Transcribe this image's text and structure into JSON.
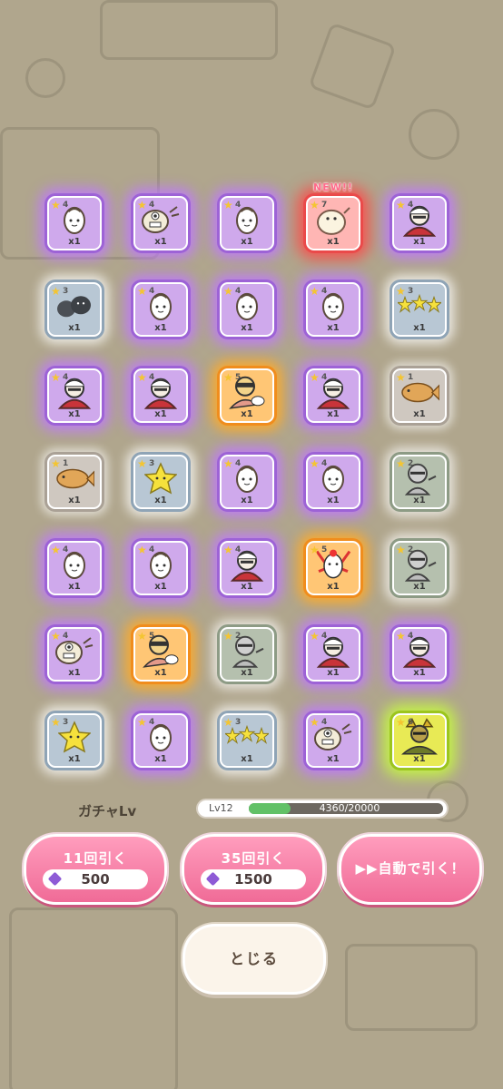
{
  "tiles": [
    {
      "rarity": "4",
      "qty": "x1",
      "color": "purple",
      "art": "egg-face"
    },
    {
      "rarity": "4",
      "qty": "x1",
      "color": "purple",
      "art": "one-eye-creature"
    },
    {
      "rarity": "4",
      "qty": "x1",
      "color": "purple",
      "art": "egg-face"
    },
    {
      "rarity": "7",
      "qty": "x1",
      "color": "red",
      "art": "blob-creature",
      "new": "NEW!!"
    },
    {
      "rarity": "4",
      "qty": "x1",
      "color": "purple",
      "art": "bandana-man"
    },
    {
      "rarity": "3",
      "qty": "x1",
      "color": "blue",
      "art": "dark-blobs"
    },
    {
      "rarity": "4",
      "qty": "x1",
      "color": "purple",
      "art": "egg-face"
    },
    {
      "rarity": "4",
      "qty": "x1",
      "color": "purple",
      "art": "egg-face"
    },
    {
      "rarity": "4",
      "qty": "x1",
      "color": "purple",
      "art": "egg-face"
    },
    {
      "rarity": "3",
      "qty": "x1",
      "color": "blue",
      "art": "three-stars"
    },
    {
      "rarity": "4",
      "qty": "x1",
      "color": "purple",
      "art": "bandana-man"
    },
    {
      "rarity": "4",
      "qty": "x1",
      "color": "purple",
      "art": "bandana-man"
    },
    {
      "rarity": "5",
      "qty": "x1",
      "color": "orange",
      "art": "masked-hero"
    },
    {
      "rarity": "4",
      "qty": "x1",
      "color": "purple",
      "art": "bandana-man"
    },
    {
      "rarity": "1",
      "qty": "x1",
      "color": "gray",
      "art": "taiyaki"
    },
    {
      "rarity": "1",
      "qty": "x1",
      "color": "gray",
      "art": "taiyaki"
    },
    {
      "rarity": "3",
      "qty": "x1",
      "color": "blue",
      "art": "star"
    },
    {
      "rarity": "4",
      "qty": "x1",
      "color": "purple",
      "art": "egg-face"
    },
    {
      "rarity": "4",
      "qty": "x1",
      "color": "purple",
      "art": "egg-face"
    },
    {
      "rarity": "2",
      "qty": "x1",
      "color": "green",
      "art": "knight"
    },
    {
      "rarity": "4",
      "qty": "x1",
      "color": "purple",
      "art": "egg-face"
    },
    {
      "rarity": "4",
      "qty": "x1",
      "color": "purple",
      "art": "egg-face"
    },
    {
      "rarity": "4",
      "qty": "x1",
      "color": "purple",
      "art": "bandana-man"
    },
    {
      "rarity": "5",
      "qty": "x1",
      "color": "orange",
      "art": "rooster-bird"
    },
    {
      "rarity": "2",
      "qty": "x1",
      "color": "green",
      "art": "knight"
    },
    {
      "rarity": "4",
      "qty": "x1",
      "color": "purple",
      "art": "one-eye-creature"
    },
    {
      "rarity": "5",
      "qty": "x1",
      "color": "orange",
      "art": "masked-hero"
    },
    {
      "rarity": "2",
      "qty": "x1",
      "color": "green",
      "art": "knight"
    },
    {
      "rarity": "4",
      "qty": "x1",
      "color": "purple",
      "art": "bandana-man"
    },
    {
      "rarity": "4",
      "qty": "x1",
      "color": "purple",
      "art": "bandana-man"
    },
    {
      "rarity": "3",
      "qty": "x1",
      "color": "blue",
      "art": "star"
    },
    {
      "rarity": "4",
      "qty": "x1",
      "color": "purple",
      "art": "egg-face"
    },
    {
      "rarity": "3",
      "qty": "x1",
      "color": "blue",
      "art": "three-stars"
    },
    {
      "rarity": "4",
      "qty": "x1",
      "color": "purple",
      "art": "one-eye-creature"
    },
    {
      "rarity": "6",
      "qty": "x1",
      "color": "lime",
      "art": "golden-warrior"
    }
  ],
  "gacha": {
    "title": "ガチャLv",
    "level": "Lv12",
    "progress_text": "4360/20000",
    "progress_fraction": 0.218
  },
  "buttons": {
    "pull11": {
      "label": "11回引く",
      "cost": "500"
    },
    "pull35": {
      "label": "35回引く",
      "cost": "1500"
    },
    "auto": {
      "label": "▶▶自動で引く！"
    },
    "close": {
      "label": "とじる"
    }
  }
}
